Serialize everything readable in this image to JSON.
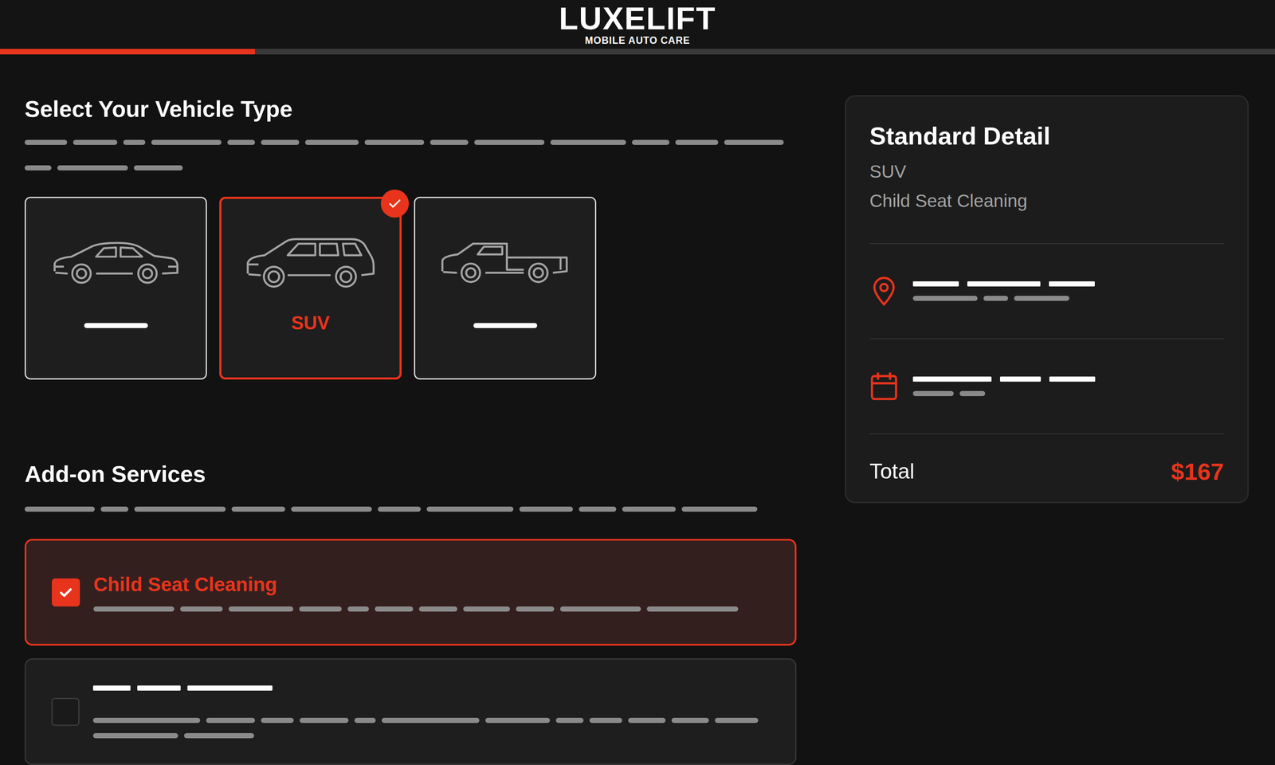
{
  "brand": {
    "name": "LUXELIFT",
    "tagline": "MOBILE AUTO CARE"
  },
  "progress": {
    "level": 0.2
  },
  "vehicle_section": {
    "title": "Select Your Vehicle Type"
  },
  "vehicles": [
    {
      "kind": "sedan",
      "selected": false
    },
    {
      "kind": "suv",
      "label": "SUV",
      "selected": true
    },
    {
      "kind": "truck",
      "selected": false
    }
  ],
  "addon_section": {
    "title": "Add-on Services"
  },
  "addons": [
    {
      "label": "Child Seat Cleaning",
      "checked": true
    },
    {
      "checked": false
    }
  ],
  "summary": {
    "title": "Standard Detail",
    "items": [
      "SUV",
      "Child Seat Cleaning"
    ],
    "total_label": "Total",
    "total": "$167"
  }
}
